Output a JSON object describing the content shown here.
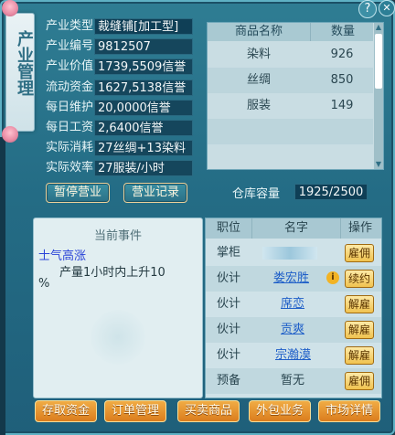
{
  "window": {
    "title_banner": "产业管理",
    "help_icon": "question-icon",
    "close_icon": "close-icon"
  },
  "info": {
    "rows": [
      {
        "label": "产业类型",
        "value": "裁缝铺[加工型]"
      },
      {
        "label": "产业编号",
        "value": "9812507"
      },
      {
        "label": "产业价值",
        "value": "1739,5509信誉"
      },
      {
        "label": "流动资金",
        "value": "1627,5138信誉"
      },
      {
        "label": "每日维护",
        "value": "20,0000信誉"
      },
      {
        "label": "每日工资",
        "value": "2,6400信誉"
      },
      {
        "label": "实际消耗",
        "value": "27丝绸+13染料"
      },
      {
        "label": "实际效率",
        "value": "27服装/小时"
      }
    ],
    "pause_button": "暂停营业",
    "records_button": "营业记录"
  },
  "goods": {
    "headers": {
      "name": "商品名称",
      "qty": "数量"
    },
    "rows": [
      {
        "name": "染料",
        "qty": "926"
      },
      {
        "name": "丝绸",
        "qty": "850"
      },
      {
        "name": "服装",
        "qty": "149"
      }
    ],
    "capacity_label": "仓库容量",
    "capacity_value": "1925/2500"
  },
  "event": {
    "title": "当前事件",
    "name": "士气高涨",
    "desc_line1": "产量1小时内上升10",
    "desc_line2": "%"
  },
  "staff": {
    "headers": {
      "position": "职位",
      "name": "名字",
      "action": "操作"
    },
    "rows": [
      {
        "position": "掌柜",
        "name": "",
        "action": "雇佣",
        "name_hidden": true
      },
      {
        "position": "伙计",
        "name": "娄宏胜",
        "action": "续约",
        "info_icon": "info-icon"
      },
      {
        "position": "伙计",
        "name": "席恋",
        "action": "解雇"
      },
      {
        "position": "伙计",
        "name": "贡爽",
        "action": "解雇"
      },
      {
        "position": "伙计",
        "name": "宗瀚漠",
        "action": "解雇"
      },
      {
        "position": "预备",
        "name": "暂无",
        "action": "雇佣"
      }
    ]
  },
  "bottom_buttons": [
    "存取资金",
    "订单管理",
    "买卖商品",
    "外包业务",
    "市场详情"
  ],
  "colors": {
    "panel": "#2f7d93",
    "button_orange": "#e58d2a",
    "link_blue": "#1f5fc8",
    "event_red": "#2a44d8"
  }
}
